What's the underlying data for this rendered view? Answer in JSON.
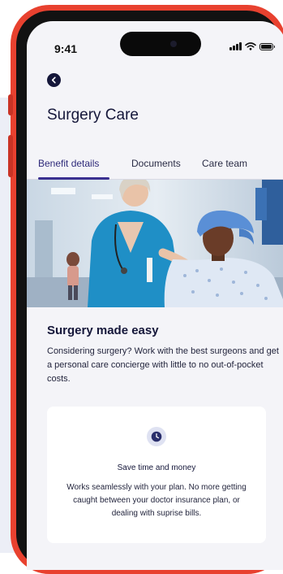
{
  "status_bar": {
    "time": "9:41"
  },
  "header": {
    "title": "Surgery Care"
  },
  "tabs": [
    {
      "label": "Benefit details",
      "active": true
    },
    {
      "label": "Documents",
      "active": false
    },
    {
      "label": "Care team",
      "active": false
    }
  ],
  "section": {
    "heading": "Surgery made easy",
    "description": "Considering surgery? Work with the best surgeons and get a personal care concierge with little to no out-of-pocket costs."
  },
  "feature_card": {
    "icon": "clock-icon",
    "title": "Save time and money",
    "body": "Works seamlessly with your plan. No more getting caught between your doctor insurance plan, or dealing with suprise bills."
  },
  "colors": {
    "phone_frame": "#e8412f",
    "primary_text": "#15173a",
    "tab_active": "#3a3090",
    "screen_bg": "#f4f4f8"
  }
}
